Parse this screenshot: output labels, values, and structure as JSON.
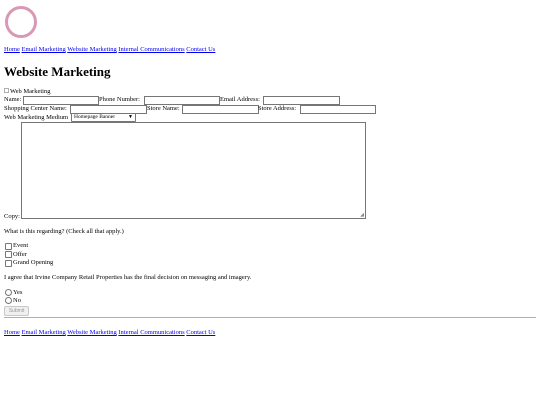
{
  "nav": {
    "home": "Home",
    "email": "Email Marketing",
    "website": "Website Marketing",
    "internal": "Internal Communications",
    "contact": "Contact Us"
  },
  "page": {
    "title": "Website Marketing",
    "image_alt": "Web Marketing"
  },
  "icons": {
    "logo": "circle-ring-logo",
    "broken_image": "broken-image-icon"
  },
  "colors": {
    "logo_ring": "#d998b3",
    "link": "#0000ee"
  },
  "form": {
    "name_label": "Name:",
    "name_value": "",
    "phone_label": "Phone Number:",
    "phone_value": "",
    "email_label": "Email Address:",
    "email_value": "",
    "center_label": "Shopping Center Name:",
    "center_value": "",
    "store_name_label": "Store Name:",
    "store_name_value": "",
    "store_address_label": "Store Address:",
    "store_address_value": "",
    "medium_label": "Web Marketing Medium",
    "medium_selected": "Homepage Banner",
    "copy_label": "Copy:",
    "copy_value": "",
    "regarding_question": "What is this regarding? (Check all that apply.)",
    "checkboxes": [
      {
        "label": "Event",
        "checked": false
      },
      {
        "label": "Offer",
        "checked": false
      },
      {
        "label": "Grand Opening",
        "checked": false
      }
    ],
    "agreement_text": "I agree that Irvine Company Retail Properties has the final decision on messaging and imagery.",
    "radios": [
      {
        "label": "Yes",
        "checked": false
      },
      {
        "label": "No",
        "checked": false
      }
    ],
    "submit_label": "Submit"
  }
}
